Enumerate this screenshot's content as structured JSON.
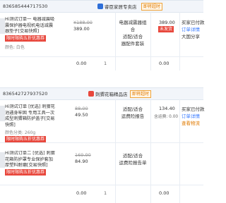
{
  "orders": [
    {
      "order_id": "836585444717530",
      "shop_name": "睿臣家居专卖店",
      "badge": "即将超时",
      "items": [
        {
          "title": "Hi测试订单一 电器减震吸震保护器电视机电话减震器垫子[交易快照]",
          "promo": "限时限购五折优惠券",
          "attr": "颜色: 白色",
          "orig_price": "¥188.00",
          "price": "389.00"
        }
      ],
      "row2_price": "0.00",
      "row2_qty": "1",
      "status_lines": [
        "电器减震器组合",
        "适配/适合",
        "器配件套装"
      ],
      "amount": "389.00",
      "amount_badge": "未发货",
      "right_lines": [
        "买家已付款",
        "订单详情",
        "大国分享"
      ]
    },
    {
      "order_id": "836542727937520",
      "shop_name": "刺猬花箱精品店",
      "badge": "即将超时",
      "items": [
        {
          "title": "Hi测试订单 [优选] 刺猬花池通身牢固 专用工具一次成型刺猬箱防护盖子[交易快照]",
          "promo": "限时限购五折优惠券",
          "attr": "颜色分类: 260g",
          "orig_price": "88.00",
          "price": "49.50"
        },
        {
          "title": "Hi测试订单二 [优选] 刺猬花箱防护罩专业保护套加厚塑料耐磨[交易快照]",
          "promo": "限时限购五折优惠券",
          "attr": "",
          "orig_price": "169.90",
          "price": "84.90"
        }
      ],
      "row2_price": "0.00",
      "row2_qty": "1",
      "status_lines": [
        "适配/适合",
        "运费险报告"
      ],
      "status_lines_2": [
        "适配/适合",
        "运费险报告单"
      ],
      "amount": "134.40",
      "amount_note": "含运费: 0.00",
      "right_lines": [
        "买家已付款",
        "订单详情"
      ],
      "right_warn": "查看物流"
    }
  ]
}
